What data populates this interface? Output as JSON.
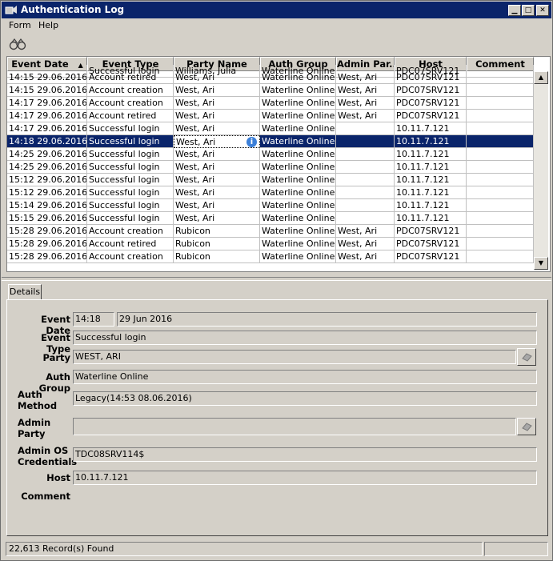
{
  "window": {
    "title": "Authentication Log"
  },
  "menu": {
    "items": [
      "Form",
      "Help"
    ]
  },
  "toolbar": {
    "binoculars_icon": "binoculars-icon"
  },
  "grid": {
    "columns": [
      "Event Date",
      "Event Type",
      "Party Name",
      "Auth Group",
      "Admin Par...",
      "Host",
      "Comment"
    ],
    "sort_indicator": "▲",
    "partial_top_row": [
      "",
      "Successful login",
      "Williams, Julia",
      "Waterline Online",
      "",
      "PDC07SRV121",
      ""
    ],
    "rows": [
      [
        "14:15 29.06.2016",
        "Account retired",
        "West, Ari",
        "Waterline Online",
        "West, Ari",
        "PDC07SRV121",
        ""
      ],
      [
        "14:15 29.06.2016",
        "Account creation",
        "West, Ari",
        "Waterline Online",
        "West, Ari",
        "PDC07SRV121",
        ""
      ],
      [
        "14:17 29.06.2016",
        "Account creation",
        "West, Ari",
        "Waterline Online",
        "West, Ari",
        "PDC07SRV121",
        ""
      ],
      [
        "14:17 29.06.2016",
        "Account retired",
        "West, Ari",
        "Waterline Online",
        "West, Ari",
        "PDC07SRV121",
        ""
      ],
      [
        "14:17 29.06.2016",
        "Successful login",
        "West, Ari",
        "Waterline Online",
        "",
        "10.11.7.121",
        ""
      ],
      [
        "14:18 29.06.2016",
        "Successful login",
        "West, Ari",
        "Waterline Online",
        "",
        "10.11.7.121",
        ""
      ],
      [
        "14:25 29.06.2016",
        "Successful login",
        "West, Ari",
        "Waterline Online",
        "",
        "10.11.7.121",
        ""
      ],
      [
        "14:25 29.06.2016",
        "Successful login",
        "West, Ari",
        "Waterline Online",
        "",
        "10.11.7.121",
        ""
      ],
      [
        "15:12 29.06.2016",
        "Successful login",
        "West, Ari",
        "Waterline Online",
        "",
        "10.11.7.121",
        ""
      ],
      [
        "15:12 29.06.2016",
        "Successful login",
        "West, Ari",
        "Waterline Online",
        "",
        "10.11.7.121",
        ""
      ],
      [
        "15:14 29.06.2016",
        "Successful login",
        "West, Ari",
        "Waterline Online",
        "",
        "10.11.7.121",
        ""
      ],
      [
        "15:15 29.06.2016",
        "Successful login",
        "West, Ari",
        "Waterline Online",
        "",
        "10.11.7.121",
        ""
      ],
      [
        "15:28 29.06.2016",
        "Account creation",
        "Rubicon",
        "Waterline Online",
        "West, Ari",
        "PDC07SRV121",
        ""
      ],
      [
        "15:28 29.06.2016",
        "Account retired",
        "Rubicon",
        "Waterline Online",
        "West, Ari",
        "PDC07SRV121",
        ""
      ],
      [
        "15:28 29.06.2016",
        "Account creation",
        "Rubicon",
        "Waterline Online",
        "West, Ari",
        "PDC07SRV121",
        ""
      ]
    ],
    "selected_row_index": 5
  },
  "details": {
    "tab_label": "Details",
    "event_date_label": "Event Date",
    "event_time": "14:18",
    "event_date": "29 Jun 2016",
    "event_type_label": "Event Type",
    "event_type": "Successful login",
    "party_label": "Party",
    "party": "WEST, ARI",
    "auth_group_label": "Auth Group",
    "auth_group": "Waterline Online",
    "auth_method_label_1": "Auth",
    "auth_method_label_2": "Method",
    "auth_method": "Legacy(14:53 08.06.2016)",
    "admin_party_label_1": "Admin",
    "admin_party_label_2": "Party",
    "admin_party": "",
    "admin_os_label_1": "Admin OS",
    "admin_os_label_2": "Credentials",
    "admin_os_credentials": "TDC08SRV114$",
    "host_label": "Host",
    "host": "10.11.7.121",
    "comment_label": "Comment"
  },
  "status": {
    "records": "22,613 Record(s) Found"
  },
  "colors": {
    "title_bar": "#0a246a",
    "selection": "#0a246a",
    "face": "#d4d0c8"
  }
}
